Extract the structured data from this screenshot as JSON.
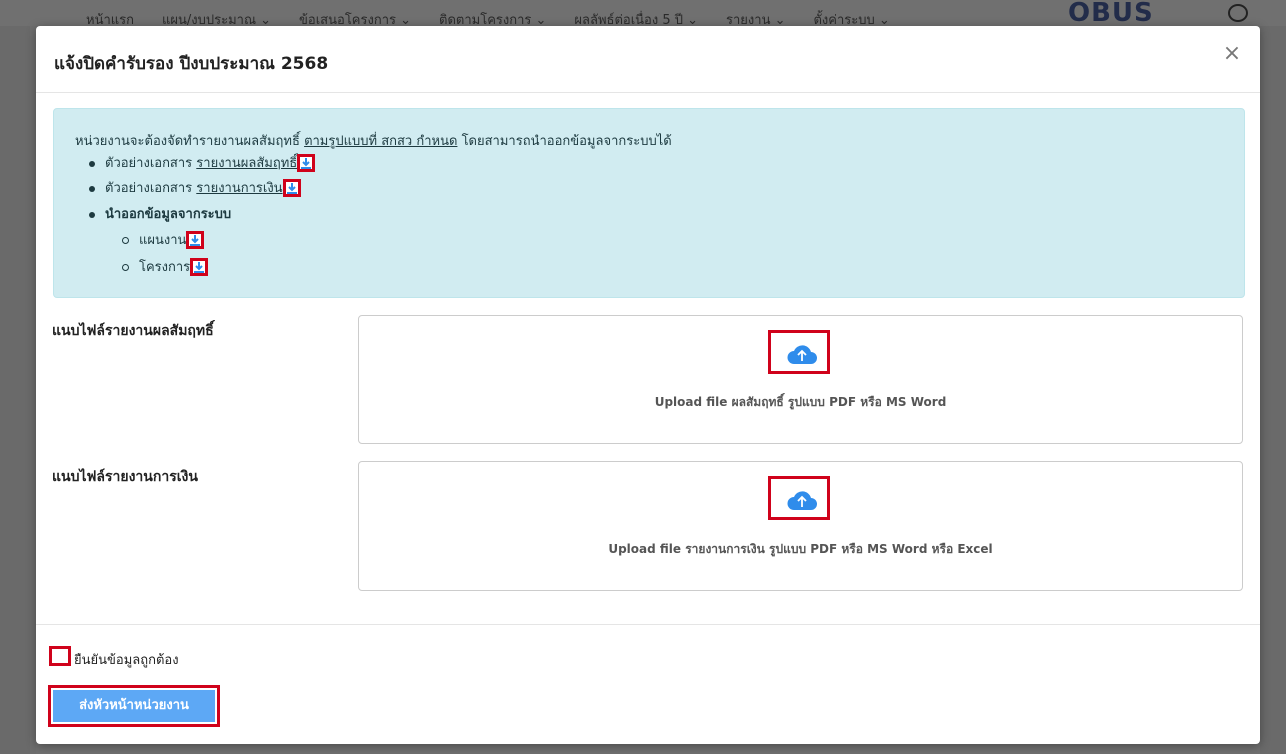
{
  "background": {
    "nav_items": [
      "หน้าแรก",
      "แผน/งบประมาณ ⌄",
      "ข้อเสนอโครงการ ⌄",
      "ติดตามโครงการ ⌄",
      "ผลลัพธ์ต่อเนื่อง 5 ปี ⌄",
      "รายงาน ⌄",
      "ตั้งค่าระบบ ⌄"
    ],
    "logo": "OBUS"
  },
  "modal": {
    "title": "แจ้งปิดคำรับรอง ปีงบประมาณ 2568",
    "close": "×",
    "info": {
      "intro_before": "หน่วยงานจะต้องจัดทำรายงานผลสัมฤทธิ์ ",
      "intro_link": "ตามรูปแบบที่ สกสว กำหนด",
      "intro_after": " โดยสามารถนำออกข้อมูลจากระบบได้",
      "item1_prefix": "ตัวอย่างเอกสาร ",
      "item1_link": "รายงานผลสัมฤทธิ์",
      "item2_prefix": "ตัวอย่างเอกสาร ",
      "item2_link": "รายงานการเงิน",
      "item3": "นำออกข้อมูลจากระบบ",
      "sub1": "แผนงาน",
      "sub2": "โครงการ"
    },
    "upload1": {
      "label": "แนบไฟล์รายงานผลสัมฤทธิ์",
      "hint": "Upload file ผลสัมฤทธิ์ รูปแบบ PDF หรือ MS Word"
    },
    "upload2": {
      "label": "แนบไฟล์รายงานการเงิน",
      "hint": "Upload file รายงานการเงิน รูปแบบ PDF หรือ MS Word หรือ Excel"
    },
    "confirm_label": "ยืนยันข้อมูลถูกต้อง",
    "submit_label": "ส่งหัวหน้าหน่วยงาน"
  },
  "colors": {
    "info_bg": "#d1ecf1",
    "highlight": "#d0021b",
    "primary": "#5da8f5",
    "icon_blue": "#2f8ceb"
  }
}
